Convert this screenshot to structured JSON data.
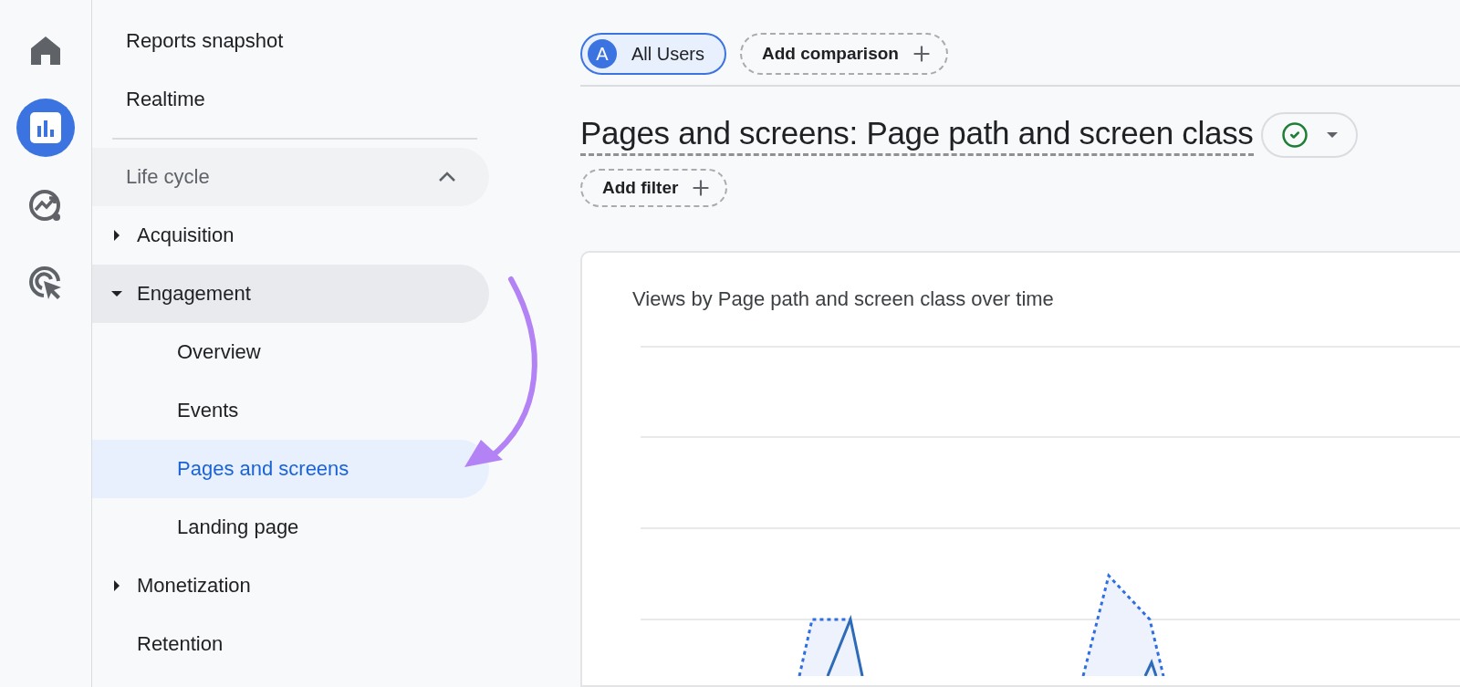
{
  "rail": [
    {
      "kind": "home",
      "selected": false
    },
    {
      "kind": "reports",
      "selected": true
    },
    {
      "kind": "explore",
      "selected": false
    },
    {
      "kind": "advertising",
      "selected": false
    }
  ],
  "nav": {
    "top_items": [
      "Reports snapshot",
      "Realtime"
    ],
    "section": {
      "label": "Life cycle",
      "expanded": true
    },
    "items": [
      {
        "label": "Acquisition",
        "expanded": false,
        "active": false
      },
      {
        "label": "Engagement",
        "expanded": true,
        "active": true,
        "children": [
          {
            "label": "Overview",
            "selected": false
          },
          {
            "label": "Events",
            "selected": false
          },
          {
            "label": "Pages and screens",
            "selected": true
          },
          {
            "label": "Landing page",
            "selected": false
          }
        ]
      },
      {
        "label": "Monetization",
        "expanded": false,
        "active": false
      },
      {
        "label": "Retention",
        "active": false
      }
    ]
  },
  "comparison": {
    "segment": {
      "badge": "A",
      "label": "All Users"
    },
    "add_comparison": "Add comparison"
  },
  "report": {
    "title": "Pages and screens: Page path and screen class",
    "add_filter": "Add filter"
  },
  "card": {
    "title": "Views by Page path and screen class over time"
  }
}
